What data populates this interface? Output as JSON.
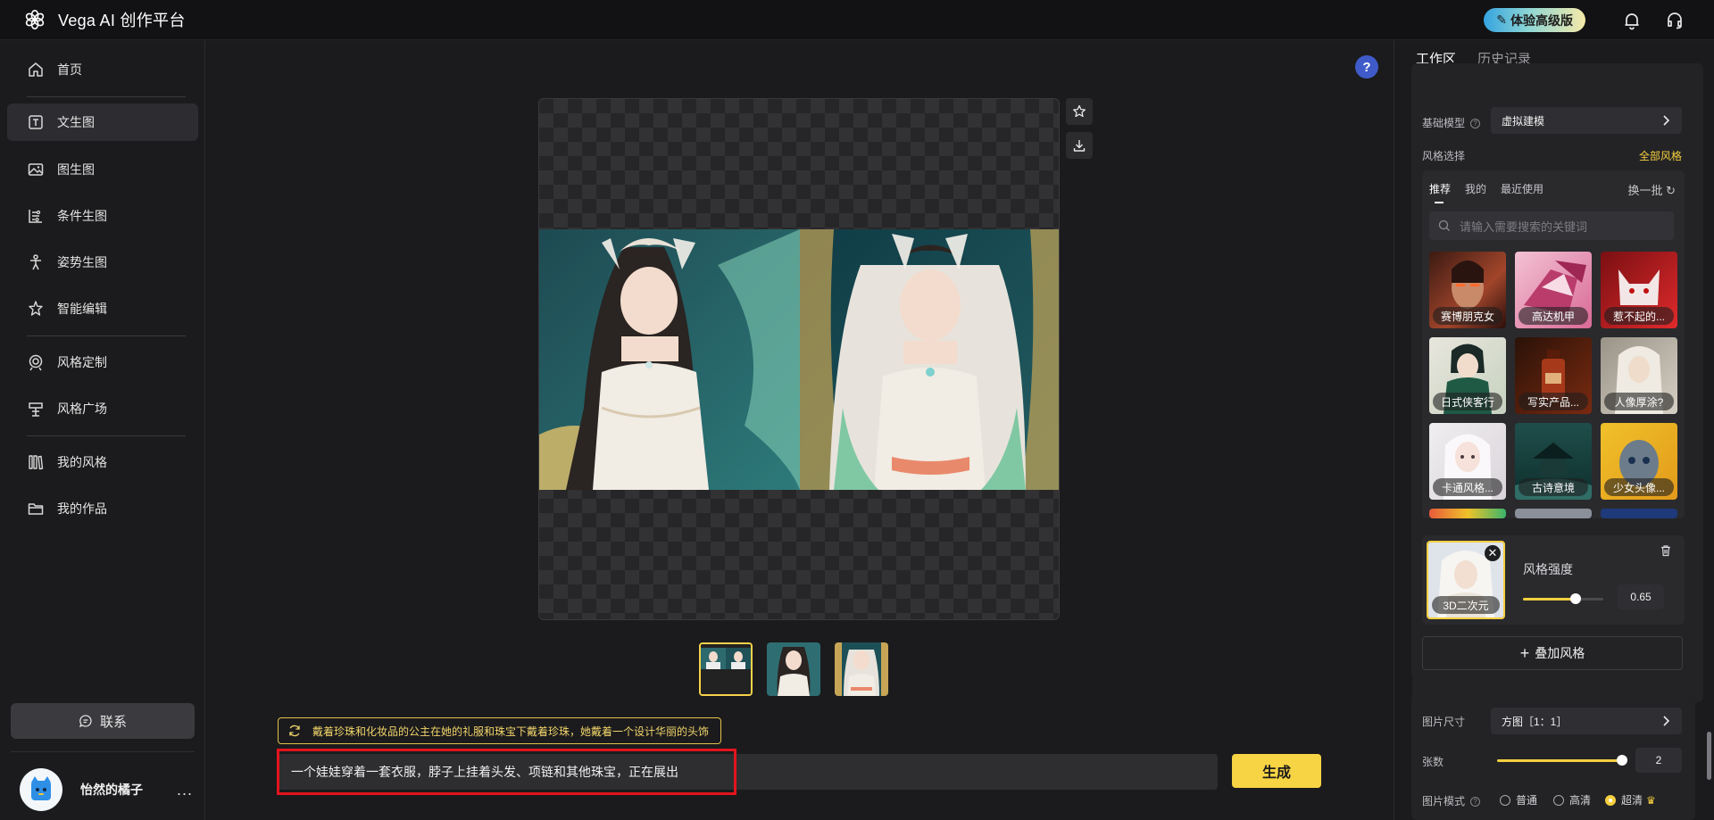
{
  "app": {
    "title": "Vega AI 创作平台"
  },
  "header": {
    "pro_label": "体验高级版"
  },
  "sidebar": {
    "items": [
      {
        "label": "首页",
        "icon": "home-icon"
      },
      {
        "label": "文生图",
        "icon": "text-image-icon",
        "active": true
      },
      {
        "label": "图生图",
        "icon": "image-icon"
      },
      {
        "label": "条件生图",
        "icon": "condition-icon"
      },
      {
        "label": "姿势生图",
        "icon": "pose-icon"
      },
      {
        "label": "智能编辑",
        "icon": "smart-edit-icon"
      },
      {
        "label": "风格定制",
        "icon": "style-custom-icon"
      },
      {
        "label": "风格广场",
        "icon": "style-square-icon"
      },
      {
        "label": "我的风格",
        "icon": "my-style-icon"
      },
      {
        "label": "我的作品",
        "icon": "folder-icon"
      }
    ],
    "contact_label": "联系",
    "user": {
      "name": "怡然的橘子",
      "more": "..."
    }
  },
  "main": {
    "help": "?",
    "prompt_suggestion": "戴着珍珠和化妆品的公主在她的礼服和珠宝下戴着珍珠，她戴着一个设计华丽的头饰",
    "prompt_value": "一个娃娃穿着一套衣服，脖子上挂着头发、项链和其他珠宝，正在展出",
    "generate_label": "生成"
  },
  "panel": {
    "tabs": [
      "工作区",
      "历史记录"
    ],
    "base_model_label": "基础模型",
    "base_model_value": "虚拟建模",
    "style_select_label": "风格选择",
    "all_styles_label": "全部风格",
    "style_tabs": [
      "推荐",
      "我的",
      "最近使用"
    ],
    "swap_label": "换一批",
    "search_placeholder": "请输入需要搜索的关键词",
    "style_tiles": [
      "赛博朋克女",
      "高达机甲",
      "惹不起的...",
      "日式侠客行",
      "写实产品...",
      "人像厚涂?",
      "卡通风格...",
      "古诗意境",
      "少女头像..."
    ],
    "selected_style": {
      "label": "3D二次元",
      "strength_label": "风格强度",
      "strength_value": "0.65",
      "strength": 0.65
    },
    "add_style_label": "叠加风格",
    "size_label": "图片尺寸",
    "size_value": "方图［1：1］",
    "count_label": "张数",
    "count_value": "2",
    "count_fraction": 1.0,
    "mode_label": "图片模式",
    "modes": [
      "普通",
      "高清",
      "超清"
    ],
    "mode_selected": "超清"
  },
  "colors": {
    "accent": "#f7d444",
    "highlight": "#e3141d",
    "help": "#3f5bc9"
  }
}
